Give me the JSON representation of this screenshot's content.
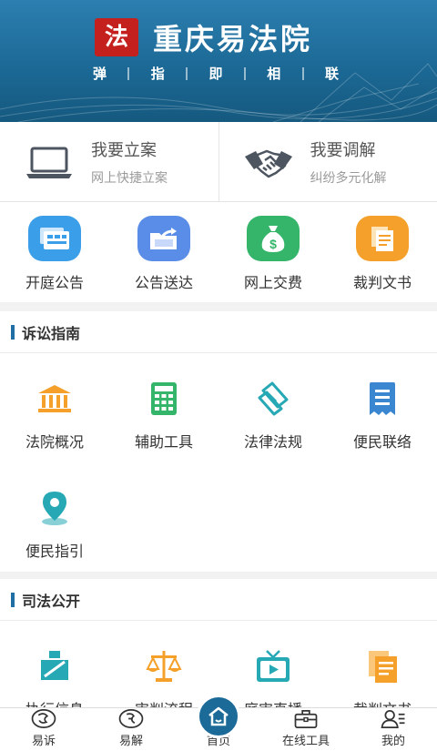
{
  "header": {
    "logo_text": "法",
    "title": "重庆易法院",
    "slogan": [
      "弹",
      "指",
      "即",
      "相",
      "联"
    ]
  },
  "actions": [
    {
      "title": "我要立案",
      "subtitle": "网上快捷立案",
      "icon": "laptop-icon"
    },
    {
      "title": "我要调解",
      "subtitle": "纠纷多元化解",
      "icon": "handshake-icon"
    }
  ],
  "quick": [
    {
      "label": "开庭公告",
      "icon": "court-notice-icon",
      "color": "#3a9ee8"
    },
    {
      "label": "公告送达",
      "icon": "folder-share-icon",
      "color": "#5a8de8"
    },
    {
      "label": "网上交费",
      "icon": "money-bag-icon",
      "color": "#34b56a"
    },
    {
      "label": "裁判文书",
      "icon": "documents-icon",
      "color": "#f5a02a"
    }
  ],
  "guide": {
    "title": "诉讼指南",
    "items": [
      {
        "label": "法院概况",
        "icon": "courthouse-icon"
      },
      {
        "label": "辅助工具",
        "icon": "calculator-icon"
      },
      {
        "label": "法律法规",
        "icon": "scroll-icon"
      },
      {
        "label": "便民联络",
        "icon": "receipt-icon"
      },
      {
        "label": "便民指引",
        "icon": "location-pin-icon"
      }
    ]
  },
  "judicial": {
    "title": "司法公开",
    "items": [
      {
        "label": "执行信息",
        "icon": "gavel-icon"
      },
      {
        "label": "审判流程",
        "icon": "scales-icon"
      },
      {
        "label": "庭审直播",
        "icon": "tv-play-icon"
      },
      {
        "label": "裁判文书",
        "icon": "documents-icon"
      }
    ]
  },
  "tabs": [
    {
      "label": "易诉",
      "icon": "yisu-icon"
    },
    {
      "label": "易解",
      "icon": "yijie-icon"
    },
    {
      "label": "首页",
      "icon": "home-icon"
    },
    {
      "label": "在线工具",
      "icon": "toolbox-icon"
    },
    {
      "label": "我的",
      "icon": "profile-icon"
    }
  ],
  "colors": {
    "brand_blue": "#1b6a98",
    "logo_red": "#c4201e",
    "icon_teal": "#26a8b5",
    "icon_orange": "#f5a02a"
  }
}
